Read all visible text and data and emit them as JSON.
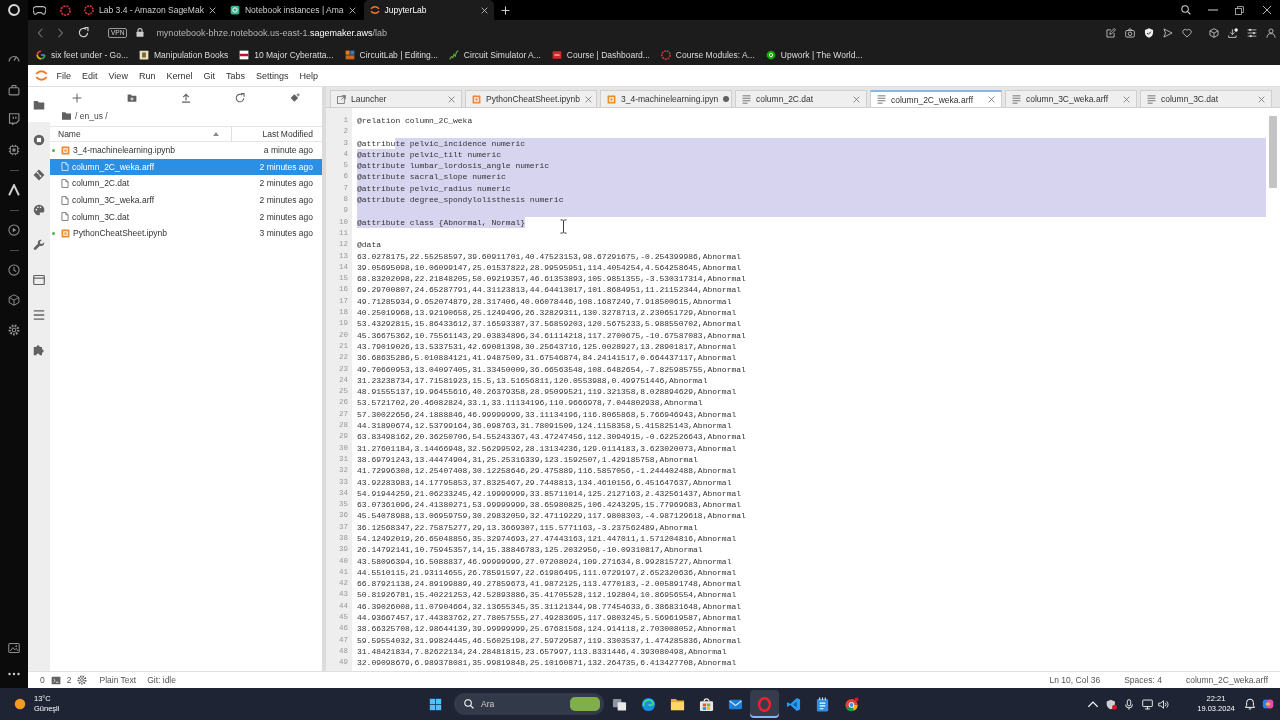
{
  "browser": {
    "tabs": [
      {
        "title": "Lab 3.4 - Amazon SageMak",
        "selected": false
      },
      {
        "title": "Notebook instances | Ama",
        "selected": false
      },
      {
        "title": "JupyterLab",
        "selected": true
      }
    ],
    "address_bar": {
      "badge": "VPN",
      "url_host": "mynotebook-bhze.notebook.us-east-1.",
      "url_domain": "sagemaker.aws",
      "url_path": "/lab"
    },
    "bookmarks": [
      "six feet under - Go...",
      "Manipulation Books",
      "10 Major Cyberatta...",
      "CircuitLab | Editing...",
      "Circuit Simulator A...",
      "Course | Dashboard...",
      "Course Modules: A...",
      "Upwork | The World..."
    ]
  },
  "jupyterlab": {
    "menu": [
      "File",
      "Edit",
      "View",
      "Run",
      "Kernel",
      "Git",
      "Tabs",
      "Settings",
      "Help"
    ],
    "sidebar_tabs": [
      {
        "selected": true
      },
      {
        "selected": false
      },
      {
        "selected": false
      },
      {
        "selected": false
      },
      {
        "selected": false
      },
      {
        "selected": false
      },
      {
        "selected": false
      },
      {
        "selected": false
      }
    ],
    "file_browser": {
      "breadcrumb": "/ en_us /",
      "columns": [
        "Name",
        "Last Modified"
      ],
      "files": [
        {
          "name": "3_4-machinelearning.ipynb",
          "modified": "a minute ago",
          "kind": "notebook",
          "running": true,
          "selected": false
        },
        {
          "name": "column_2C_weka.arff",
          "modified": "2 minutes ago",
          "kind": "file",
          "running": false,
          "selected": true
        },
        {
          "name": "column_2C.dat",
          "modified": "2 minutes ago",
          "kind": "file",
          "running": false,
          "selected": false
        },
        {
          "name": "column_3C_weka.arff",
          "modified": "2 minutes ago",
          "kind": "file",
          "running": false,
          "selected": false
        },
        {
          "name": "column_3C.dat",
          "modified": "2 minutes ago",
          "kind": "file",
          "running": false,
          "selected": false
        },
        {
          "name": "PythonCheatSheet.ipynb",
          "modified": "3 minutes ago",
          "kind": "notebook",
          "running": true,
          "selected": false
        }
      ]
    },
    "tabs": [
      {
        "label": "Launcher",
        "kind": "launcher",
        "selected": false,
        "unsaved": false
      },
      {
        "label": "PythonCheatSheet.ipynb",
        "kind": "notebook",
        "selected": false,
        "unsaved": false
      },
      {
        "label": "3_4-machinelearning.ipyn",
        "kind": "notebook",
        "selected": false,
        "unsaved": true
      },
      {
        "label": "column_2C.dat",
        "kind": "text",
        "selected": false,
        "unsaved": false
      },
      {
        "label": "column_2C_weka.arff",
        "kind": "text",
        "selected": true,
        "unsaved": false
      },
      {
        "label": "column_3C_weka.arff",
        "kind": "text",
        "selected": false,
        "unsaved": false
      },
      {
        "label": "column_3C.dat",
        "kind": "text",
        "selected": false,
        "unsaved": false
      }
    ],
    "editor": {
      "lines": [
        {
          "number": "1",
          "text": "@relation column_2C_weka",
          "selected": false
        },
        {
          "number": "2",
          "selected": false
        },
        {
          "number": "3",
          "parts": [
            {
              "text": "@attribu",
              "selected": false
            },
            {
              "text": "te pelvic_incidence numeric",
              "selected": true
            }
          ],
          "selected": true
        },
        {
          "number": "4",
          "text": "@attribute pelvic_tilt numeric",
          "selected": true
        },
        {
          "number": "5",
          "text": "@attribute lumbar_lordosis_angle numeric",
          "selected": true
        },
        {
          "number": "6",
          "text": "@attribute sacral_slope numeric",
          "selected": true
        },
        {
          "number": "7",
          "text": "@attribute pelvic_radius numeric",
          "selected": true
        },
        {
          "number": "8",
          "text": "@attribute degree_spondylolisthesis numeric",
          "selected": true
        },
        {
          "number": "9",
          "selected": true
        },
        {
          "number": "10",
          "parts": [
            {
              "text": "@attribute class {Abnormal, Normal}",
              "selected": true
            }
          ],
          "selected": false
        },
        {
          "number": "11",
          "selected": false
        },
        {
          "number": "12",
          "text": "@data",
          "selected": false
        },
        {
          "number": "13",
          "text": "63.0278175,22.55258597,39.60911701,40.47523153,98.67291675,-0.254399986,Abnormal",
          "selected": false
        },
        {
          "number": "14",
          "text": "39.05695098,10.06099147,25.01537822,28.99595951,114.4054254,4.564258645,Abnormal",
          "selected": false
        },
        {
          "number": "15",
          "text": "68.83202098,22.21848205,50.09219357,46.61353893,105.9851355,-3.530317314,Abnormal",
          "selected": false
        },
        {
          "number": "16",
          "text": "69.29700807,24.65287791,44.31123813,44.64413017,101.8684951,11.21152344,Abnormal",
          "selected": false
        },
        {
          "number": "17",
          "text": "49.71285934,9.652074879,28.317406,40.06078446,108.1687249,7.918500615,Abnormal",
          "selected": false
        },
        {
          "number": "18",
          "text": "40.25019968,13.92190658,25.1249496,26.32829311,130.3278713,2.230651729,Abnormal",
          "selected": false
        },
        {
          "number": "19",
          "text": "53.43292815,15.86433612,37.16593387,37.56859203,120.5675233,5.988550702,Abnormal",
          "selected": false
        },
        {
          "number": "20",
          "text": "45.36675362,10.75561143,29.03834896,34.61114218,117.2700675,-10.67587083,Abnormal",
          "selected": false
        },
        {
          "number": "21",
          "text": "43.79019026,13.5337531,42.69081398,30.25643716,125.0028927,13.28901817,Abnormal",
          "selected": false
        },
        {
          "number": "22",
          "text": "36.68635286,5.010884121,41.9487509,31.67546874,84.24141517,0.664437117,Abnormal",
          "selected": false
        },
        {
          "number": "23",
          "text": "49.70660953,13.04097405,31.33450009,36.66563548,108.6482654,-7.825985755,Abnormal",
          "selected": false
        },
        {
          "number": "24",
          "text": "31.23238734,17.71581923,15.5,13.51656811,120.0553988,0.499751446,Abnormal",
          "selected": false
        },
        {
          "number": "25",
          "text": "48.91555137,19.96455616,40.26379358,28.95099521,119.321358,8.028894629,Abnormal",
          "selected": false
        },
        {
          "number": "26",
          "text": "53.5721702,20.46082824,33.1,33.11134196,110.9666978,7.044802938,Abnormal",
          "selected": false
        },
        {
          "number": "27",
          "text": "57.30022656,24.1888846,46.99999999,33.11134196,116.8065868,5.766946943,Abnormal",
          "selected": false
        },
        {
          "number": "28",
          "text": "44.31890674,12.53799164,36.098763,31.78091509,124.1158358,5.415825143,Abnormal",
          "selected": false
        },
        {
          "number": "29",
          "text": "63.83498162,20.36250706,54.55243367,43.47247456,112.3094915,-0.622526643,Abnormal",
          "selected": false
        },
        {
          "number": "30",
          "text": "31.27601184,3.14466948,32.56299592,28.13134236,129.0114183,3.623020073,Abnormal",
          "selected": false
        },
        {
          "number": "31",
          "text": "38.69791243,13.44474904,31,25.25316339,123.1592507,1.429185758,Abnormal",
          "selected": false
        },
        {
          "number": "32",
          "text": "41.72996308,12.25407408,30.12258646,29.475889,116.5857056,-1.244402488,Abnormal",
          "selected": false
        },
        {
          "number": "33",
          "text": "43.92283983,14.17795853,37.8325467,29.7448813,134.4610156,6.451647637,Abnormal",
          "selected": false
        },
        {
          "number": "34",
          "text": "54.91944259,21.06233245,42.19999999,33.85711014,125.2127163,2.432561437,Abnormal",
          "selected": false
        },
        {
          "number": "35",
          "text": "63.07361096,24.41380271,53.99999999,38.65980825,106.4243295,15.77969683,Abnormal",
          "selected": false
        },
        {
          "number": "36",
          "text": "45.54078988,13.06959759,30.29832059,32.47119229,117.9808303,-4.987129618,Abnormal",
          "selected": false
        },
        {
          "number": "37",
          "text": "36.12568347,22.75875277,29,13.3669307,115.5771163,-3.237562489,Abnormal",
          "selected": false
        },
        {
          "number": "38",
          "text": "54.12492019,26.65048856,35.32974693,27.47443163,121.447011,1.571204816,Abnormal",
          "selected": false
        },
        {
          "number": "39",
          "text": "26.14792141,10.75945357,14,15.38846783,125.2032956,-10.09310817,Abnormal",
          "selected": false
        },
        {
          "number": "40",
          "text": "43.58096394,16.5088837,46.99999999,27.07208024,109.271634,8.992815727,Abnormal",
          "selected": false
        },
        {
          "number": "41",
          "text": "44.5510115,21.93114655,26.78591597,22.61986495,111.0729197,2.652320636,Abnormal",
          "selected": false
        },
        {
          "number": "42",
          "text": "66.87921138,24.89199889,49.27859673,41.9872125,113.4770183,-2.005891748,Abnormal",
          "selected": false
        },
        {
          "number": "43",
          "text": "50.81926781,15.40221253,42.52893886,35.41705528,112.192804,10.86956554,Abnormal",
          "selected": false
        },
        {
          "number": "44",
          "text": "46.39026008,11.07904664,32.13655345,35.31121344,98.77454633,6.386831648,Abnormal",
          "selected": false
        },
        {
          "number": "45",
          "text": "44.93667457,17.44383762,27.78057555,27.49283695,117.9803245,5.569619587,Abnormal",
          "selected": false
        },
        {
          "number": "46",
          "text": "38.66325708,12.98644139,39.99999999,25.67681568,124.914118,2.703008052,Abnormal",
          "selected": false
        },
        {
          "number": "47",
          "text": "59.59554032,31.99824445,46.56025198,27.59729587,119.3303537,1.474285836,Abnormal",
          "selected": false
        },
        {
          "number": "48",
          "text": "31.48421834,7.82622134,24.28481815,23.657997,113.8331446,4.393080498,Abnormal",
          "selected": false
        },
        {
          "number": "49",
          "text": "32.09098679,6.989378081,35.99819848,25.10160871,132.264735,6.413427708,Abnormal",
          "selected": false
        }
      ]
    },
    "status_bar": {
      "terminals": "0",
      "kernels": "2",
      "mode": "Plain Text",
      "git": "Git: idle",
      "cursor": "Ln 10, Col 36",
      "indent": "Spaces: 4",
      "file": "column_2C_weka.arff"
    }
  },
  "taskbar": {
    "weather": {
      "temperature": "13°C",
      "condition": "Güneşli"
    },
    "search": {
      "placeholder": "Ara"
    },
    "apps": [
      {
        "selected": false
      },
      {
        "selected": false
      },
      {
        "selected": false
      },
      {
        "selected": false
      },
      {
        "selected": false
      },
      {
        "selected": true
      },
      {
        "selected": false
      },
      {
        "selected": false
      },
      {
        "selected": false
      }
    ],
    "clock": {
      "time": "22:21",
      "date": "19.03.2024"
    }
  }
}
